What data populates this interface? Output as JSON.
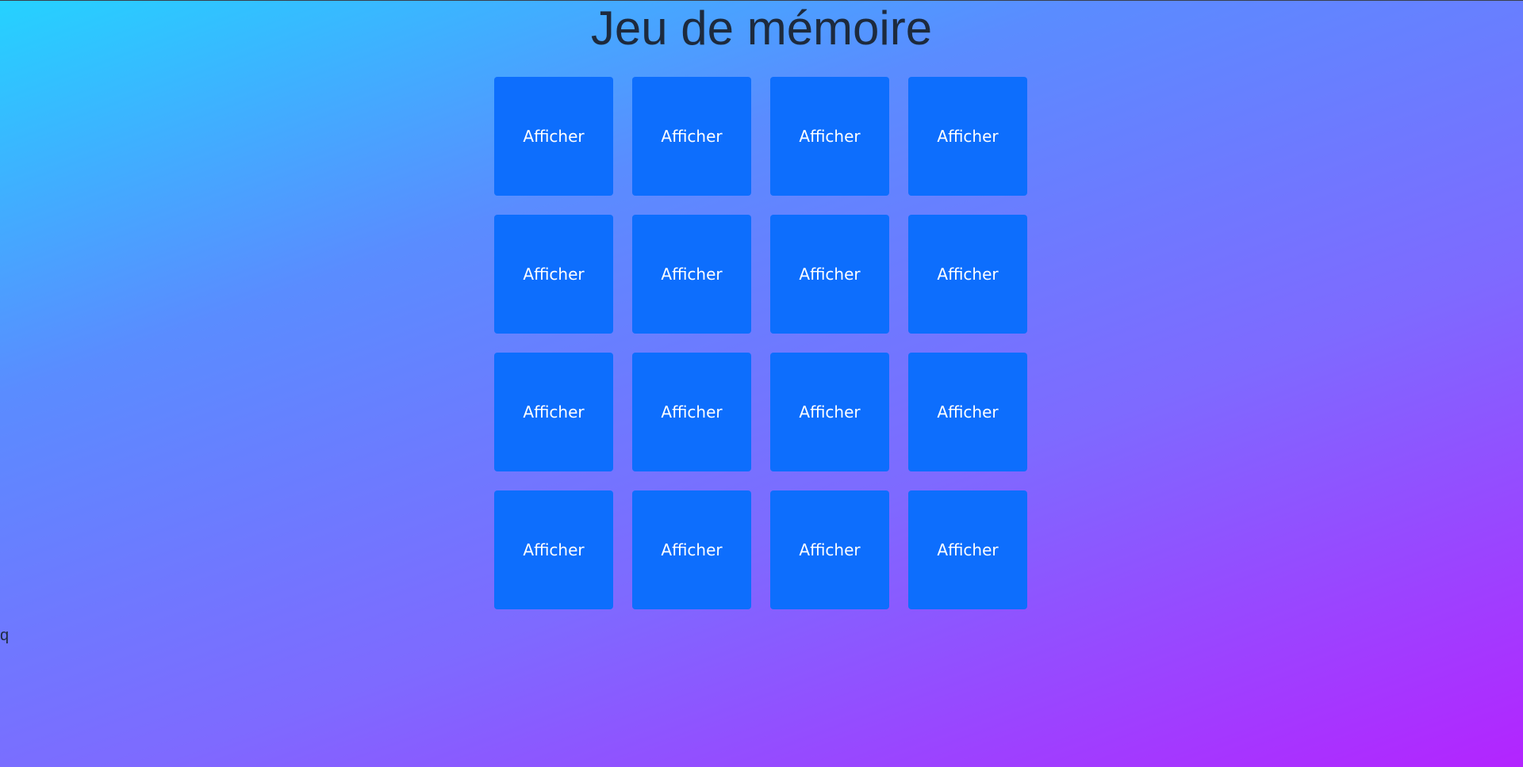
{
  "page": {
    "title": "Jeu de mémoire",
    "stray_text": "q",
    "background_gradient": [
      "#25d2ff",
      "#5a8cff",
      "#7e6aff",
      "#b324ff"
    ]
  },
  "board": {
    "rows": 4,
    "columns": 4,
    "card_color": "#0d6efd",
    "cards": [
      {
        "label": "Afficher"
      },
      {
        "label": "Afficher"
      },
      {
        "label": "Afficher"
      },
      {
        "label": "Afficher"
      },
      {
        "label": "Afficher"
      },
      {
        "label": "Afficher"
      },
      {
        "label": "Afficher"
      },
      {
        "label": "Afficher"
      },
      {
        "label": "Afficher"
      },
      {
        "label": "Afficher"
      },
      {
        "label": "Afficher"
      },
      {
        "label": "Afficher"
      },
      {
        "label": "Afficher"
      },
      {
        "label": "Afficher"
      },
      {
        "label": "Afficher"
      },
      {
        "label": "Afficher"
      }
    ]
  }
}
